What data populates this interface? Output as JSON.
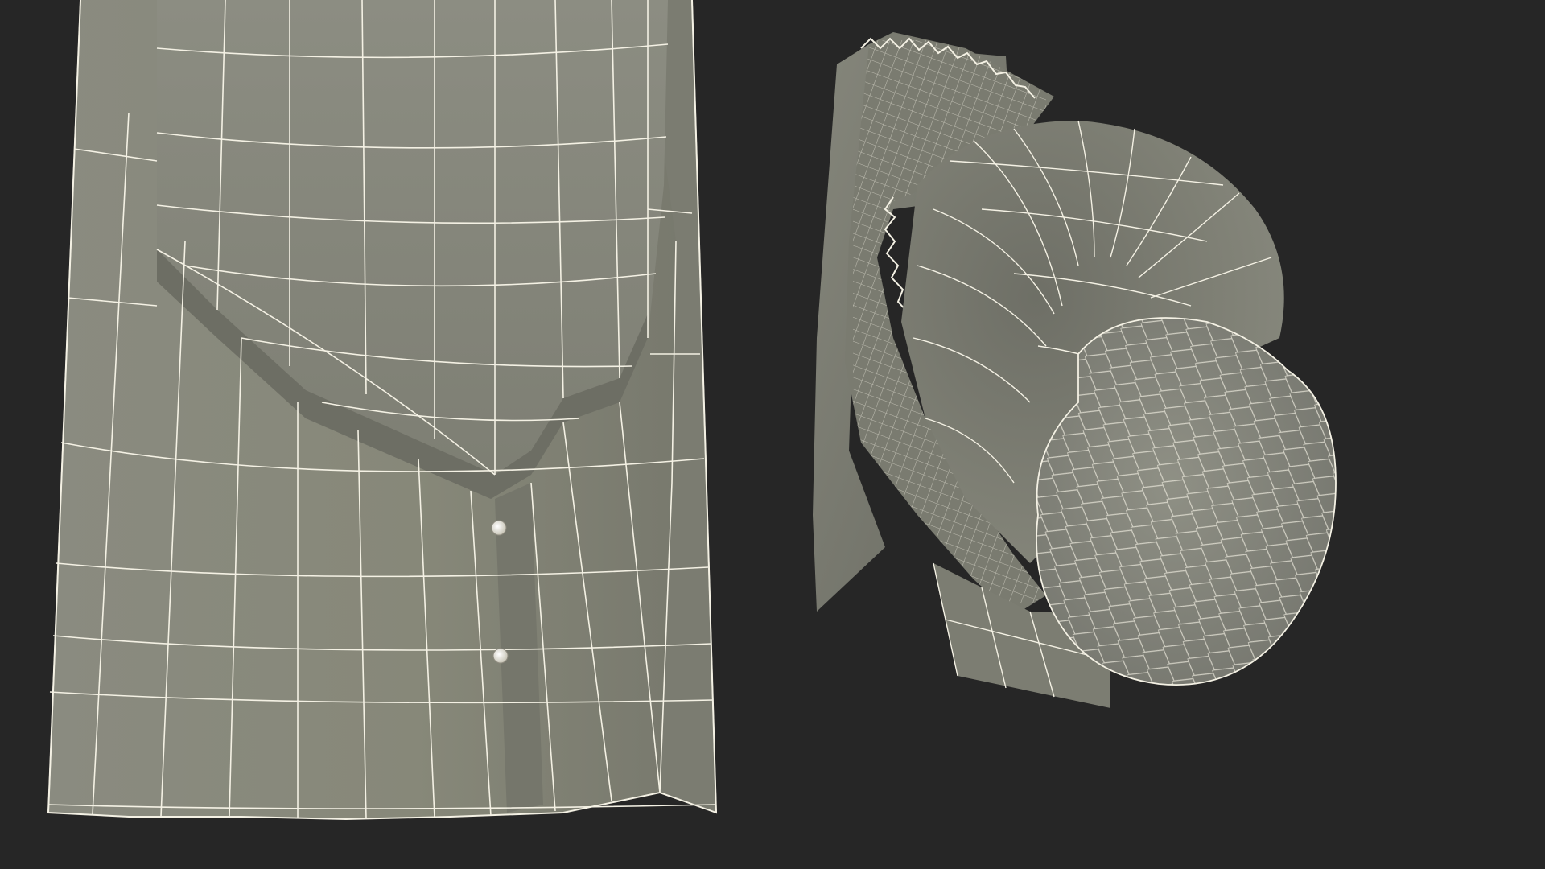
{
  "scene": {
    "background_color": "#262626",
    "mesh_fill_color": "#84857a",
    "mesh_shadow_color": "#5f6058",
    "wire_color": "#f4f1e4",
    "button_color": "#e9e6da"
  },
  "views": [
    {
      "name": "coat-lower-hem-wireframe"
    },
    {
      "name": "collar-and-hair-bun-wireframe"
    }
  ]
}
